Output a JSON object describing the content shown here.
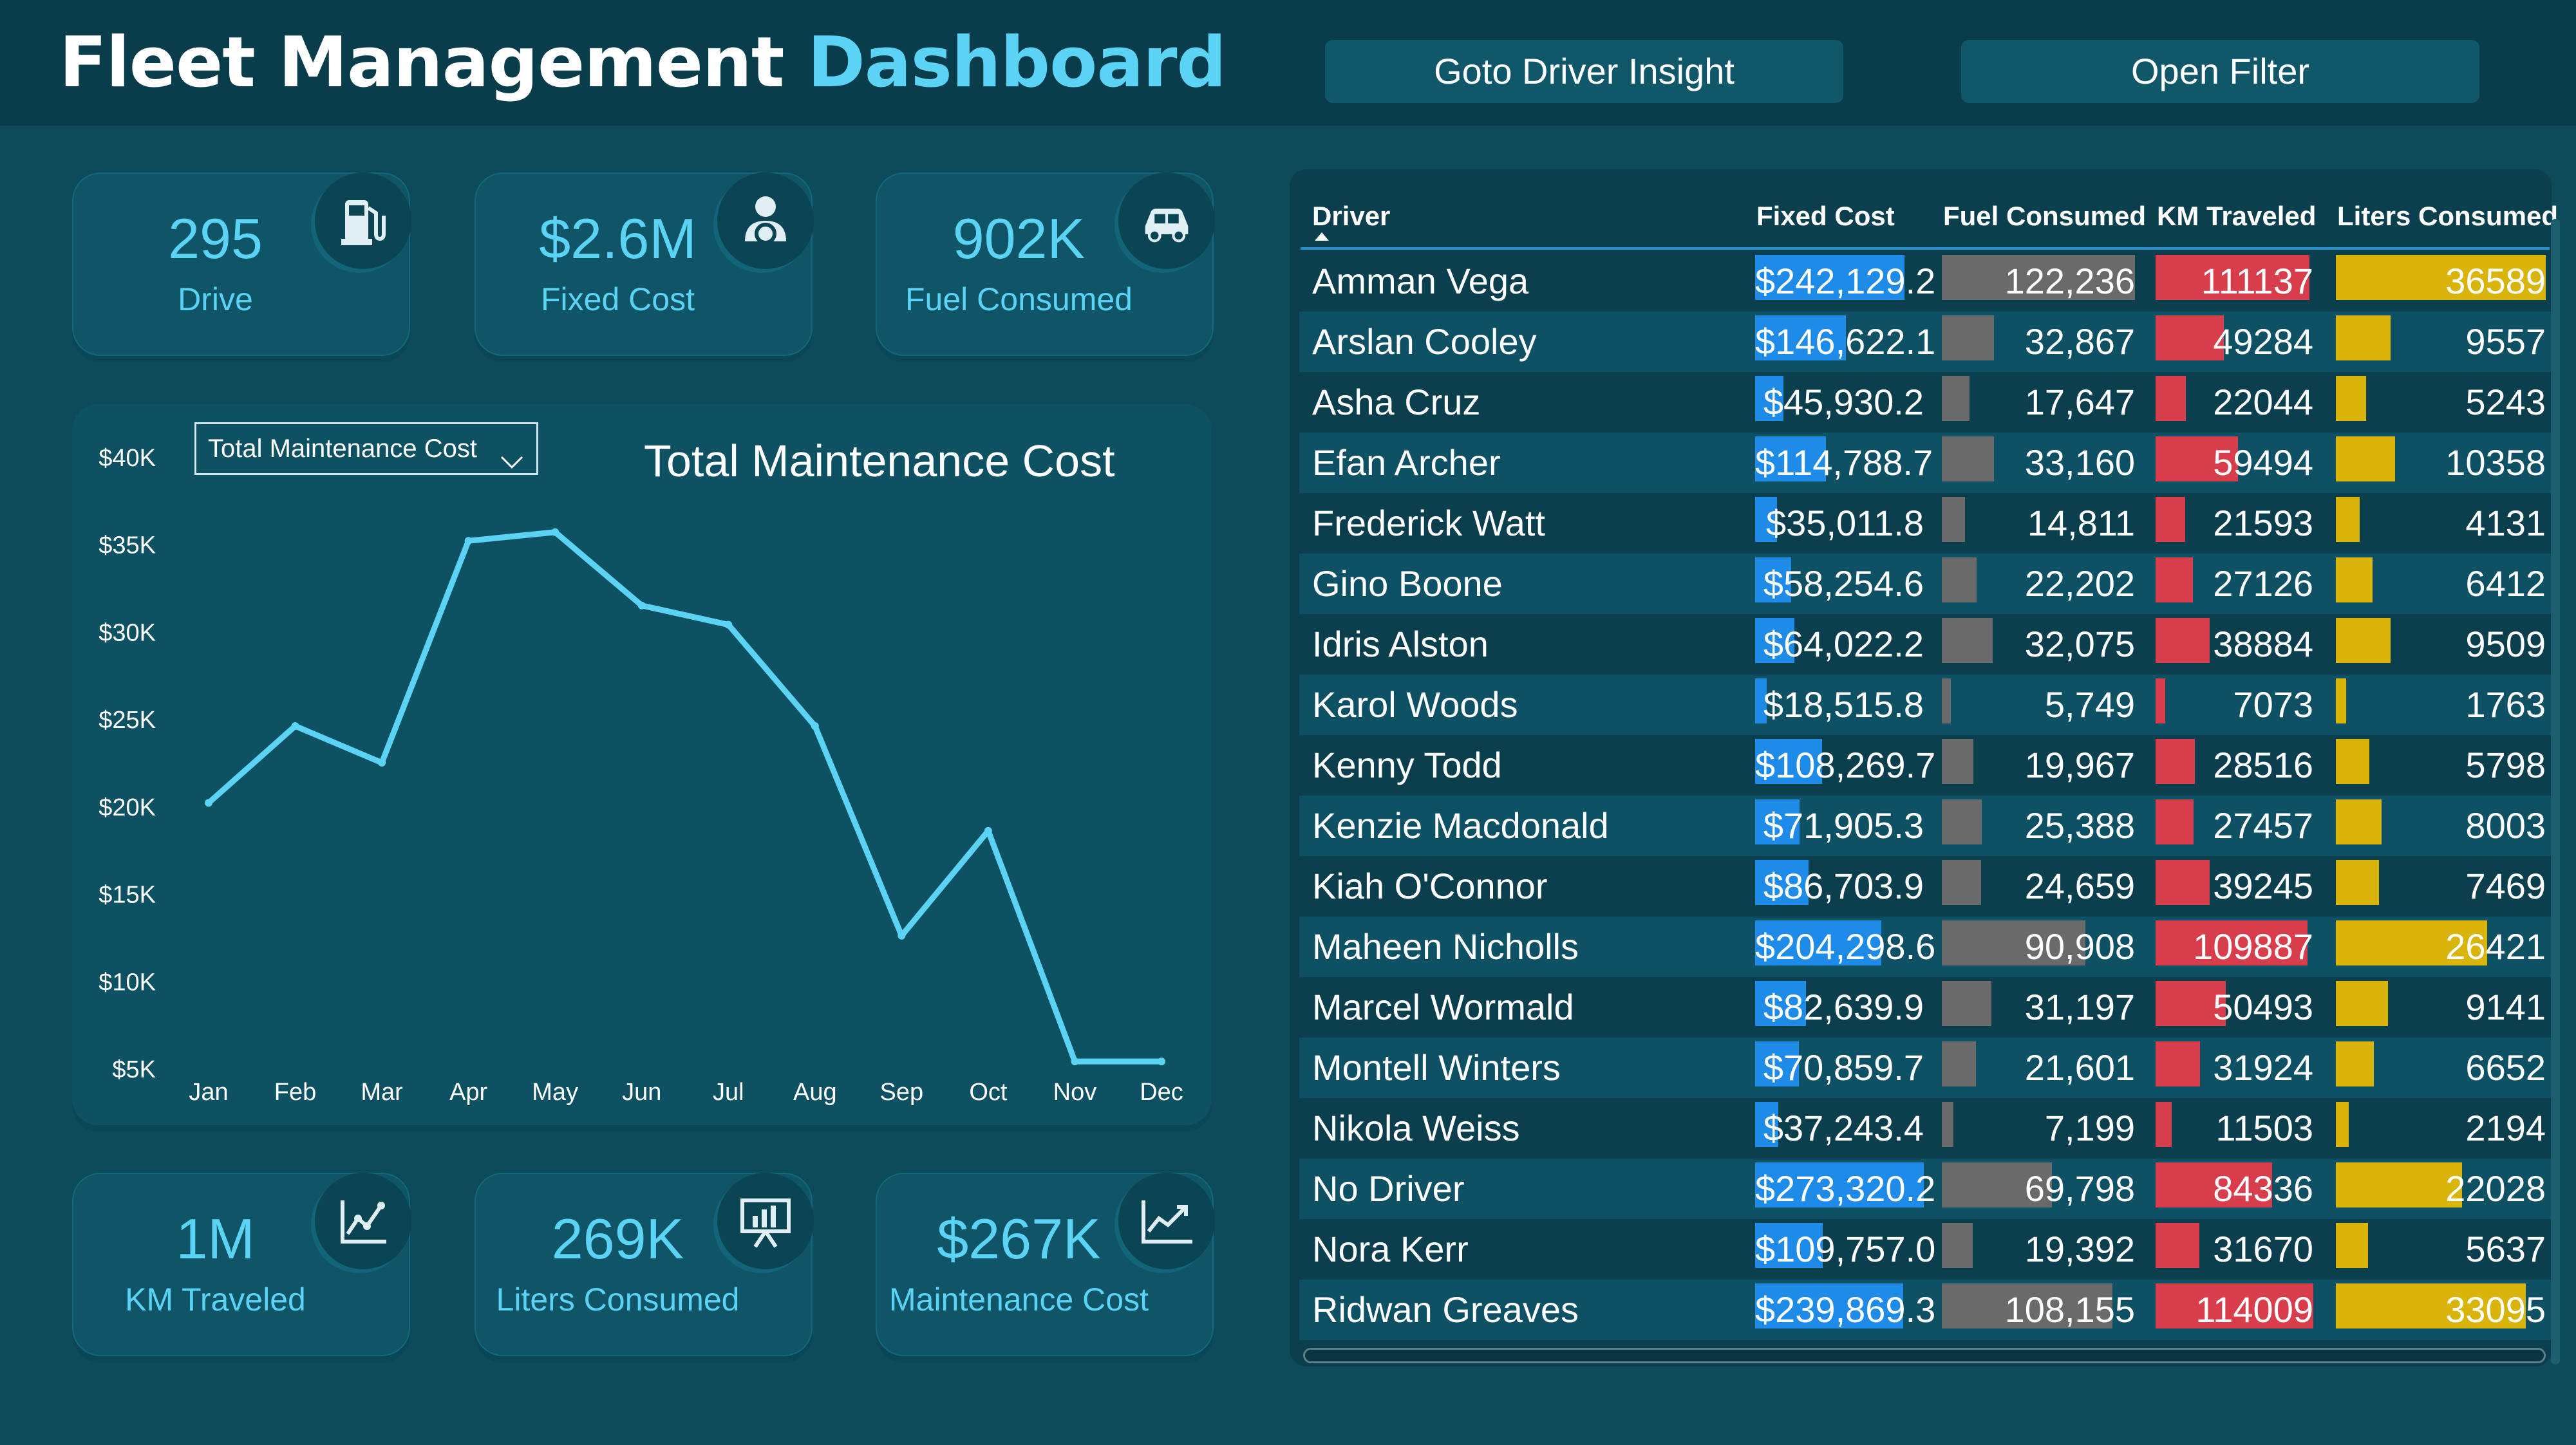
{
  "header": {
    "title_main": "Fleet Management",
    "title_accent": "Dashboard",
    "buttons": {
      "driver_insight": "Goto Driver Insight",
      "open_filter": "Open Filter"
    }
  },
  "kpis": {
    "drive": {
      "value": "295",
      "label": "Drive",
      "icon": "fuel-pump-icon"
    },
    "fixed_cost": {
      "value": "$2.6M",
      "label": "Fixed Cost",
      "icon": "driver-icon"
    },
    "fuel_consumed": {
      "value": "902K",
      "label": "Fuel Consumed",
      "icon": "car-icon"
    },
    "km_traveled": {
      "value": "1M",
      "label": "KM Traveled",
      "icon": "line-chart-icon"
    },
    "liters_consumed": {
      "value": "269K",
      "label": "Liters Consumed",
      "icon": "presentation-chart-icon"
    },
    "maintenance_cost": {
      "value": "$267K",
      "label": "Maintenance Cost",
      "icon": "trend-up-icon"
    }
  },
  "chart": {
    "dropdown_value": "Total Maintenance Cost",
    "title": "Total Maintenance Cost"
  },
  "chart_data": {
    "type": "line",
    "title": "Total Maintenance Cost",
    "categories": [
      "Jan",
      "Feb",
      "Mar",
      "Apr",
      "May",
      "Jun",
      "Jul",
      "Aug",
      "Sep",
      "Oct",
      "Nov",
      "Dec"
    ],
    "values": [
      20200,
      24600,
      22500,
      35200,
      35700,
      31500,
      30400,
      24600,
      12600,
      18600,
      5400,
      5400
    ],
    "ylim": [
      5000,
      40000
    ],
    "yticks": [
      "$5K",
      "$10K",
      "$15K",
      "$20K",
      "$25K",
      "$30K",
      "$35K",
      "$40K"
    ],
    "ytick_values": [
      5000,
      10000,
      15000,
      20000,
      25000,
      30000,
      35000,
      40000
    ],
    "line_color": "#5ad3f5",
    "grid": false
  },
  "table": {
    "headers": {
      "driver": "Driver",
      "fixed_cost": "Fixed Cost",
      "fuel": "Fuel Consumed",
      "km": "KM Traveled",
      "liters": "Liters Consumed"
    },
    "colors": {
      "fixed_cost": "#1f8be8",
      "fuel": "#6a6a6a",
      "km": "#d83d4c",
      "liters": "#d9b40a"
    },
    "max": {
      "fixed_cost": 273320.2,
      "fuel": 122236,
      "km": 114009,
      "liters": 36589
    },
    "rows": [
      {
        "driver": "Amman Vega",
        "fixed_cost": "$242,129.2",
        "fixed_cost_v": 242129.2,
        "fuel": "122,236",
        "fuel_v": 122236,
        "km": "111137",
        "km_v": 111137,
        "liters": "36589",
        "liters_v": 36589
      },
      {
        "driver": "Arslan Cooley",
        "fixed_cost": "$146,622.1",
        "fixed_cost_v": 146622.1,
        "fuel": "32,867",
        "fuel_v": 32867,
        "km": "49284",
        "km_v": 49284,
        "liters": "9557",
        "liters_v": 9557
      },
      {
        "driver": "Asha Cruz",
        "fixed_cost": "$45,930.2",
        "fixed_cost_v": 45930.2,
        "fuel": "17,647",
        "fuel_v": 17647,
        "km": "22044",
        "km_v": 22044,
        "liters": "5243",
        "liters_v": 5243
      },
      {
        "driver": "Efan Archer",
        "fixed_cost": "$114,788.7",
        "fixed_cost_v": 114788.7,
        "fuel": "33,160",
        "fuel_v": 33160,
        "km": "59494",
        "km_v": 59494,
        "liters": "10358",
        "liters_v": 10358
      },
      {
        "driver": "Frederick Watt",
        "fixed_cost": "$35,011.8",
        "fixed_cost_v": 35011.8,
        "fuel": "14,811",
        "fuel_v": 14811,
        "km": "21593",
        "km_v": 21593,
        "liters": "4131",
        "liters_v": 4131
      },
      {
        "driver": "Gino Boone",
        "fixed_cost": "$58,254.6",
        "fixed_cost_v": 58254.6,
        "fuel": "22,202",
        "fuel_v": 22202,
        "km": "27126",
        "km_v": 27126,
        "liters": "6412",
        "liters_v": 6412
      },
      {
        "driver": "Idris Alston",
        "fixed_cost": "$64,022.2",
        "fixed_cost_v": 64022.2,
        "fuel": "32,075",
        "fuel_v": 32075,
        "km": "38884",
        "km_v": 38884,
        "liters": "9509",
        "liters_v": 9509
      },
      {
        "driver": "Karol Woods",
        "fixed_cost": "$18,515.8",
        "fixed_cost_v": 18515.8,
        "fuel": "5,749",
        "fuel_v": 5749,
        "km": "7073",
        "km_v": 7073,
        "liters": "1763",
        "liters_v": 1763
      },
      {
        "driver": "Kenny Todd",
        "fixed_cost": "$108,269.7",
        "fixed_cost_v": 108269.7,
        "fuel": "19,967",
        "fuel_v": 19967,
        "km": "28516",
        "km_v": 28516,
        "liters": "5798",
        "liters_v": 5798
      },
      {
        "driver": "Kenzie Macdonald",
        "fixed_cost": "$71,905.3",
        "fixed_cost_v": 71905.3,
        "fuel": "25,388",
        "fuel_v": 25388,
        "km": "27457",
        "km_v": 27457,
        "liters": "8003",
        "liters_v": 8003
      },
      {
        "driver": "Kiah O'Connor",
        "fixed_cost": "$86,703.9",
        "fixed_cost_v": 86703.9,
        "fuel": "24,659",
        "fuel_v": 24659,
        "km": "39245",
        "km_v": 39245,
        "liters": "7469",
        "liters_v": 7469
      },
      {
        "driver": "Maheen Nicholls",
        "fixed_cost": "$204,298.6",
        "fixed_cost_v": 204298.6,
        "fuel": "90,908",
        "fuel_v": 90908,
        "km": "109887",
        "km_v": 109887,
        "liters": "26421",
        "liters_v": 26421
      },
      {
        "driver": "Marcel Wormald",
        "fixed_cost": "$82,639.9",
        "fixed_cost_v": 82639.9,
        "fuel": "31,197",
        "fuel_v": 31197,
        "km": "50493",
        "km_v": 50493,
        "liters": "9141",
        "liters_v": 9141
      },
      {
        "driver": "Montell Winters",
        "fixed_cost": "$70,859.7",
        "fixed_cost_v": 70859.7,
        "fuel": "21,601",
        "fuel_v": 21601,
        "km": "31924",
        "km_v": 31924,
        "liters": "6652",
        "liters_v": 6652
      },
      {
        "driver": "Nikola Weiss",
        "fixed_cost": "$37,243.4",
        "fixed_cost_v": 37243.4,
        "fuel": "7,199",
        "fuel_v": 7199,
        "km": "11503",
        "km_v": 11503,
        "liters": "2194",
        "liters_v": 2194
      },
      {
        "driver": "No Driver",
        "fixed_cost": "$273,320.2",
        "fixed_cost_v": 273320.2,
        "fuel": "69,798",
        "fuel_v": 69798,
        "km": "84336",
        "km_v": 84336,
        "liters": "22028",
        "liters_v": 22028
      },
      {
        "driver": "Nora Kerr",
        "fixed_cost": "$109,757.0",
        "fixed_cost_v": 109757.0,
        "fuel": "19,392",
        "fuel_v": 19392,
        "km": "31670",
        "km_v": 31670,
        "liters": "5637",
        "liters_v": 5637
      },
      {
        "driver": "Ridwan Greaves",
        "fixed_cost": "$239,869.3",
        "fixed_cost_v": 239869.3,
        "fuel": "108,155",
        "fuel_v": 108155,
        "km": "114009",
        "km_v": 114009,
        "liters": "33095",
        "liters_v": 33095
      }
    ]
  }
}
